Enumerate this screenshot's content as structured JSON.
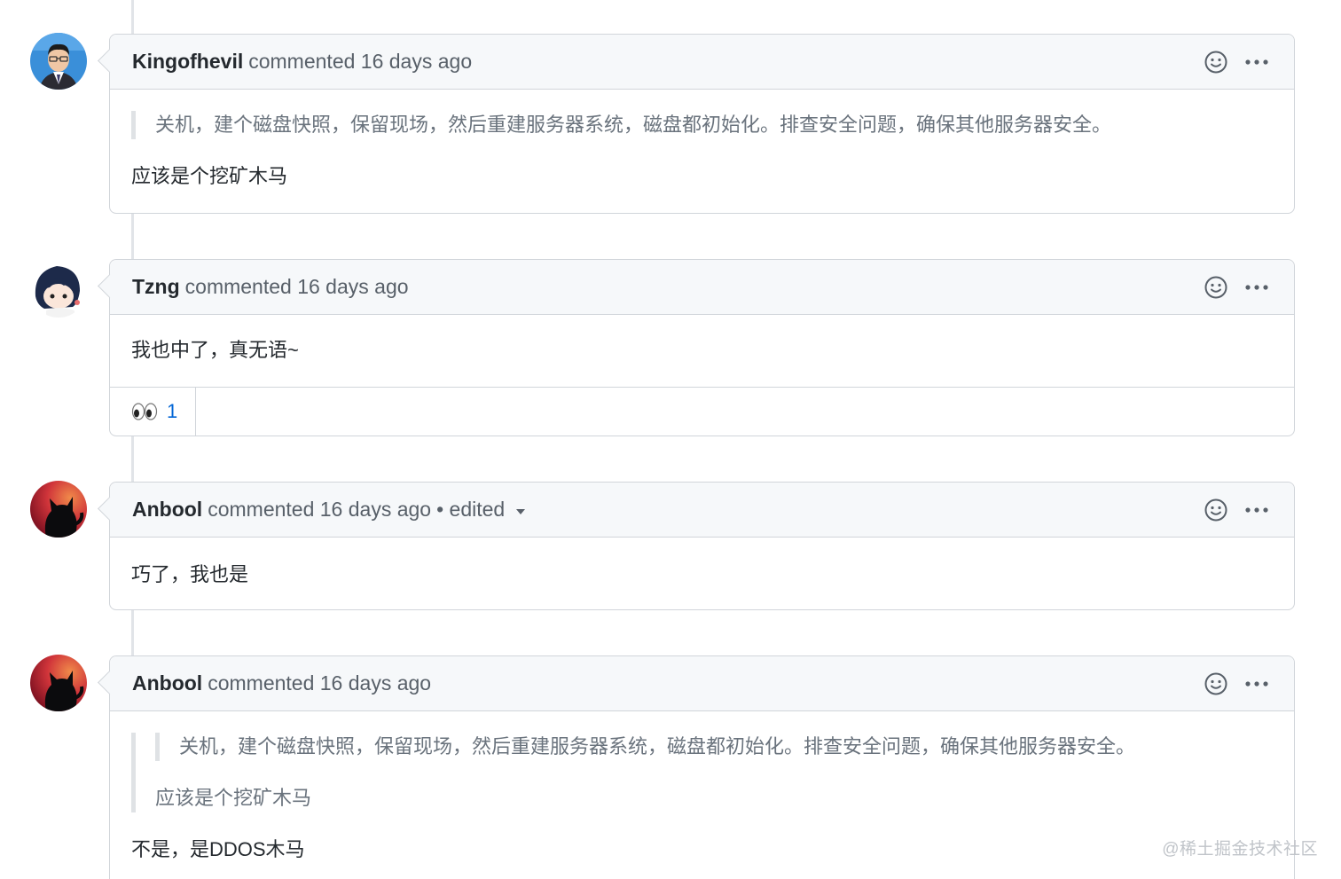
{
  "comments": [
    {
      "author": "Kingofhevil",
      "meta": "commented 16 days ago",
      "avatar_icon": "portrait-man-avatar",
      "quote": [
        "关机，建个磁盘快照，保留现场，然后重建服务器系统，磁盘都初始化。排查安全问题，确保其他服务器安全。"
      ],
      "body": "应该是个挖矿木马"
    },
    {
      "author": "Tzng",
      "meta": "commented 16 days ago",
      "avatar_icon": "anime-avatar",
      "body": "我也中了，真无语~",
      "reactions": [
        {
          "emoji": "👀",
          "count": "1"
        }
      ]
    },
    {
      "author": "Anbool",
      "meta": "commented 16 days ago",
      "edited": "• edited",
      "avatar_icon": "black-cat-avatar",
      "body": "巧了，我也是"
    },
    {
      "author": "Anbool",
      "meta": "commented 16 days ago",
      "avatar_icon": "black-cat-avatar",
      "nested_quote": "关机，建个磁盘快照，保留现场，然后重建服务器系统，磁盘都初始化。排查安全问题，确保其他服务器安全。",
      "quote_line": "应该是个挖矿木马",
      "body": "不是，是DDOS木马"
    }
  ],
  "icons": {
    "emoji": "smiley-icon",
    "more": "kebab-horizontal-icon",
    "caret": "caret-down-icon"
  },
  "colors": {
    "header_bg": "#f6f8fa",
    "border": "#d1d5da",
    "link": "#0366d6",
    "muted": "#586069"
  },
  "watermark": "@稀土掘金技术社区"
}
